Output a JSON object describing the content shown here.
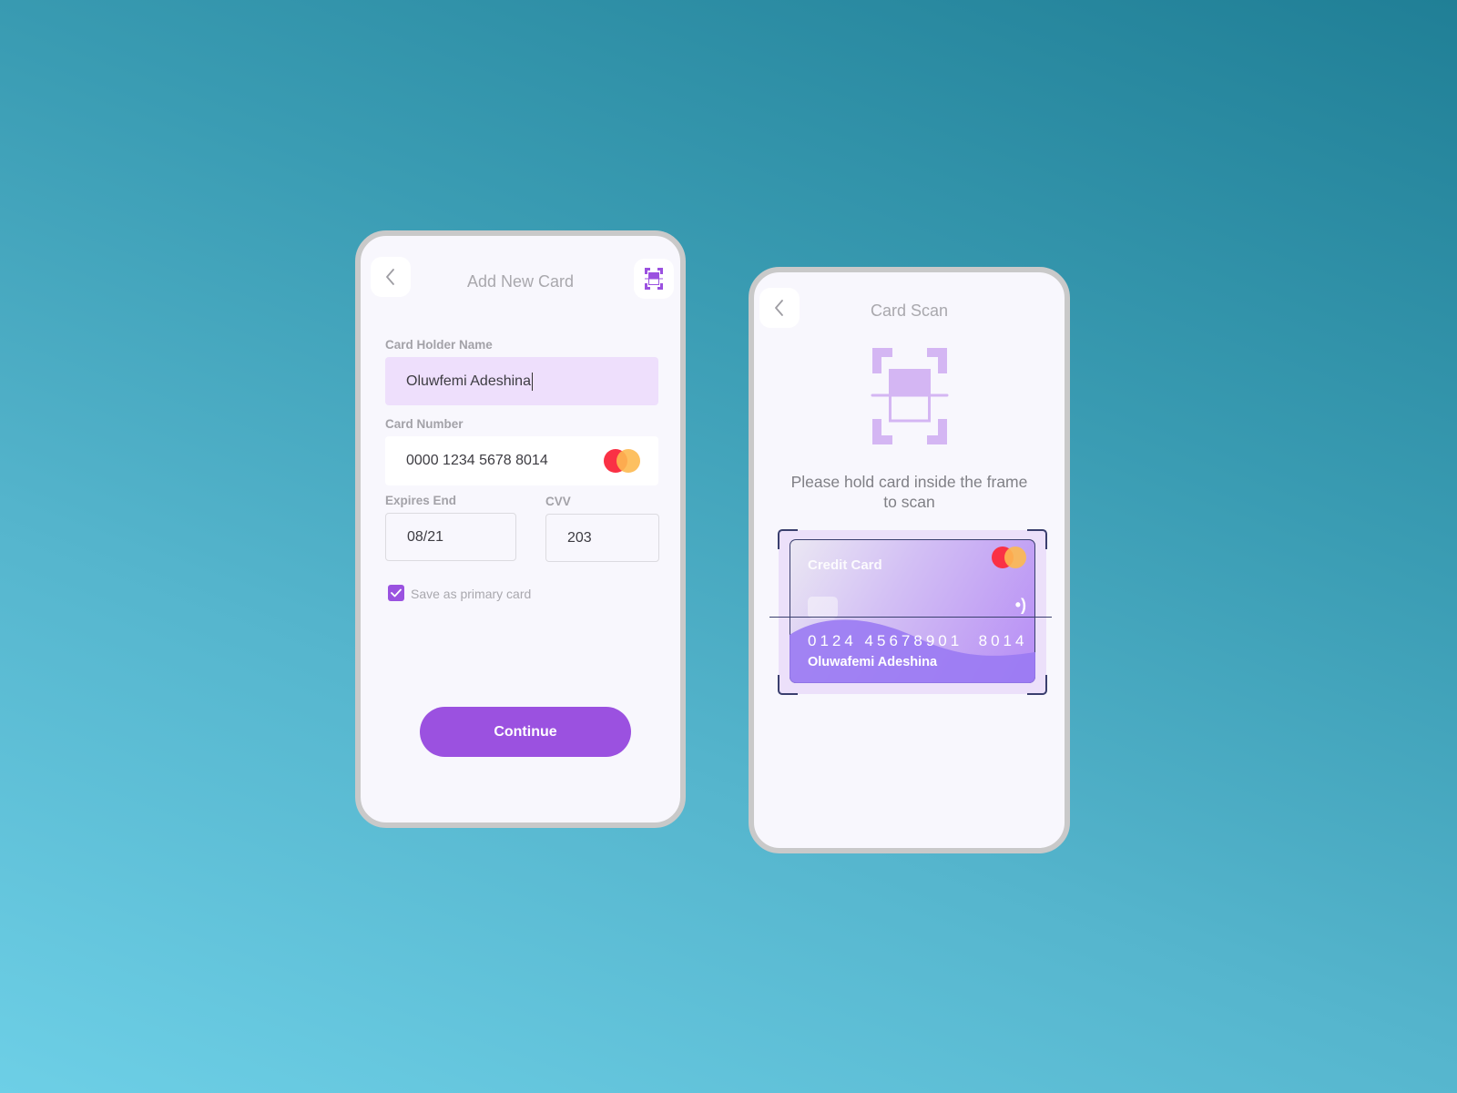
{
  "add_card_screen": {
    "title": "Add New Card",
    "back_icon": "chevron-left-icon",
    "scan_icon": "scan-icon",
    "holder_name": {
      "label": "Card Holder Name",
      "value": "Oluwfemi Adeshina"
    },
    "card_number": {
      "label": "Card Number",
      "value": "0000 1234 5678 8014",
      "brand_icon": "mastercard-logo"
    },
    "expiry": {
      "label": "Expires End",
      "value": "08/21"
    },
    "cvv": {
      "label": "CVV",
      "value": "203"
    },
    "primary_checkbox": {
      "label": "Save as primary card",
      "checked": true
    },
    "continue_label": "Continue"
  },
  "card_scan_screen": {
    "title": "Card Scan",
    "back_icon": "chevron-left-icon",
    "illustration_icon": "scan-icon",
    "instruction": "Please hold card inside the frame to scan",
    "preview_card": {
      "type_label": "Credit Card",
      "number": "0124 45678901  8014",
      "holder": "Oluwafemi Adeshina",
      "brand_icon": "mastercard-logo",
      "contactless_icon": "nfc-icon"
    }
  },
  "colors": {
    "accent": "#9b51e0",
    "name_field_bg": "#eedffc",
    "scan_icon": "#d4b6f3",
    "frame": "#3a3f6e"
  }
}
